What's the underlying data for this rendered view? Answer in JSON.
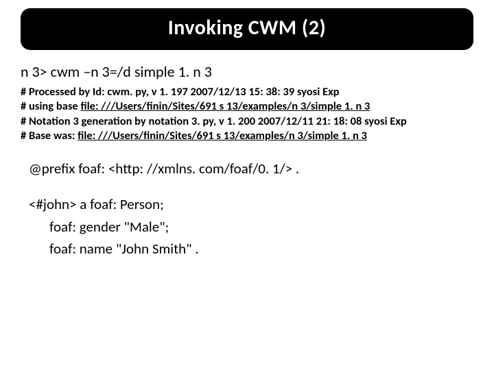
{
  "title": "Invoking CWM (2)",
  "cmd": "n 3> cwm –n 3=/d   simple 1. n 3",
  "comments": {
    "l1_pre": "# Processed by Id: cwm. py, v 1. 197 2007/12/13 15: 38: 39 syosi Exp",
    "l2_pre": "# using base ",
    "l2_link": "file: ///Users/finin/Sites/691 s 13/examples/n 3/simple 1. n 3",
    "l3_pre": "#   Notation 3 generation by   notation 3. py, v 1. 200 2007/12/11 21: 18: 08 syosi Exp",
    "l4_pre": "#   Base was: ",
    "l4_link": "file: ///Users/finin/Sites/691 s 13/examples/n 3/simple 1. n 3"
  },
  "rdf": {
    "prefix": "@prefix foaf: <http: //xmlns. com/foaf/0. 1/> .",
    "s1": "<#john>     a foaf: Person;",
    "s2": "foaf: gender \"Male\";",
    "s3": "foaf: name \"John Smith\" ."
  }
}
